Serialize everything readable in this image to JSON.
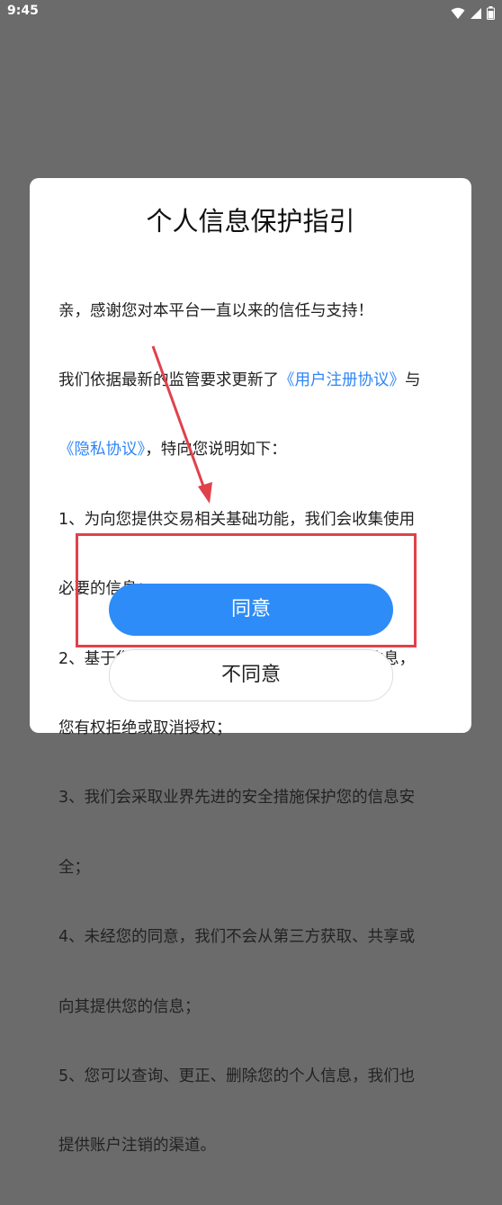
{
  "status_bar": {
    "time": "9:45",
    "icons": [
      "wifi-icon",
      "signal-icon",
      "battery-icon"
    ]
  },
  "dialog": {
    "title": "个人信息保护指引",
    "body": {
      "line1": "亲，感谢您对本平台一直以来的信任与支持！",
      "line2_pre": "我们依据最新的监管要求更新了",
      "user_agreement_link": "《用户注册协议》",
      "line2_post": "与",
      "privacy_link": "《隐私协议》",
      "line3_post": "，特向您说明如下：",
      "item1_a": "1、为向您提供交易相关基础功能，我们会收集使用",
      "item1_b": "必要的信息；",
      "item2_a": "2、基于您的授权我们可能会获取您的位置等信息，",
      "item2_b": "您有权拒绝或取消授权；",
      "item3_a": "3、我们会采取业界先进的安全措施保护您的信息安",
      "item3_b": "全；",
      "item4_a": "4、未经您的同意，我们不会从第三方获取、共享或",
      "item4_b": "向其提供您的信息；",
      "item5_a": "5、您可以查询、更正、删除您的个人信息，我们也",
      "item5_b": "提供账户注销的渠道。"
    },
    "agree_label": "同意",
    "disagree_label": "不同意"
  },
  "colors": {
    "overlay": "#6b6b6b",
    "link": "#2f86f6",
    "primary_button": "#2d8cf8",
    "annotation": "#e0414b"
  }
}
